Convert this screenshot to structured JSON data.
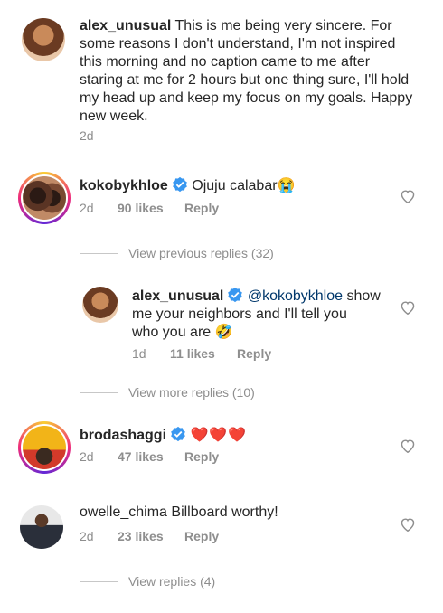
{
  "caption": {
    "username": "alex_unusual",
    "text": "This is me being very sincere. For some reasons I don't understand, I'm not inspired this morning and no caption came to me after staring at me for 2 hours but one thing sure, I'll hold my head up and keep my focus on my goals. Happy new week.",
    "time": "2d"
  },
  "comments": [
    {
      "username": "kokobykhloe",
      "verified": true,
      "text": "Ojuju calabar😭",
      "time": "2d",
      "likes": "90 likes",
      "reply": "Reply",
      "view_replies": "View previous replies (32)"
    },
    {
      "username": "alex_unusual",
      "verified": true,
      "mention": "@kokobykhloe",
      "text_line1": " show",
      "text_line2": "me your neighbors and I'll tell you",
      "text_line3": "who you are 🤣",
      "time": "1d",
      "likes": "11 likes",
      "reply": "Reply",
      "view_more": "View more replies (10)"
    },
    {
      "username": "brodashaggi",
      "verified": true,
      "text": "❤️❤️❤️",
      "time": "2d",
      "likes": "47 likes",
      "reply": "Reply"
    },
    {
      "username": "owelle_chima",
      "verified": false,
      "text": "Billboard worthy!",
      "time": "2d",
      "likes": "23 likes",
      "reply": "Reply",
      "view_replies": "View replies (4)"
    }
  ]
}
